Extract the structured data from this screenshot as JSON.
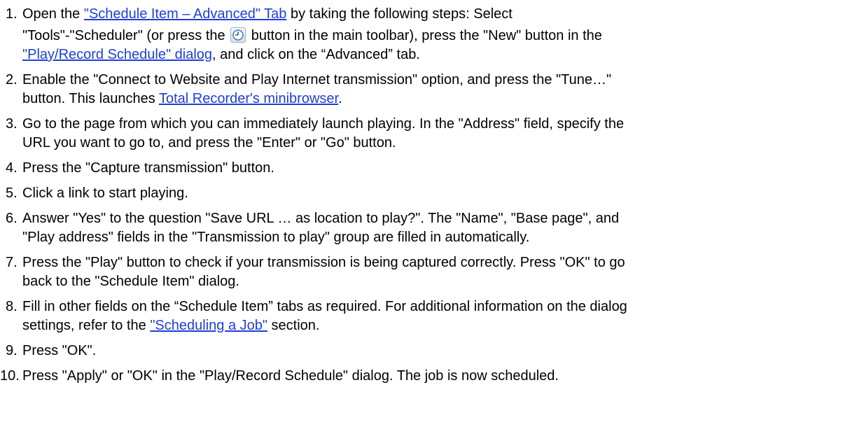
{
  "steps": [
    {
      "number": "1.",
      "line1": {
        "a": "Open the ",
        "link": "\"Schedule Item – Advanced\" Tab",
        "b": " by taking the following steps: Select"
      },
      "line2": {
        "a": "\"Tools\"-\"Scheduler\" (or press the ",
        "icon": "scheduler-clock-icon",
        "b": " button in the main toolbar), press the \"New\" button in the"
      },
      "line3": {
        "link": "\"Play/Record Schedule\" dialog",
        "b": ", and click on the “Advanced” tab."
      }
    },
    {
      "number": "2.",
      "line1": "Enable the \"Connect to Website and Play Internet transmission\" option, and press the \"Tune…\"",
      "line2": {
        "a": "button. This launches ",
        "link": "Total Recorder's minibrowser",
        "b": "."
      }
    },
    {
      "number": "3.",
      "line1": "Go to the page from which you can immediately launch playing. In the \"Address\" field, specify the",
      "line2": "URL you want to go to, and press the \"Enter\" or \"Go\" button."
    },
    {
      "number": "4.",
      "line1": "Press the \"Capture transmission\" button."
    },
    {
      "number": "5.",
      "line1": "Click a link to start playing."
    },
    {
      "number": "6.",
      "line1": "Answer \"Yes\" to the question \"Save URL … as location to play?\". The \"Name\", \"Base page\", and",
      "line2": "\"Play address\" fields in the \"Transmission to play\" group are filled in automatically."
    },
    {
      "number": "7.",
      "line1": "Press the \"Play\" button to check if your transmission is being captured correctly. Press \"OK\" to go",
      "line2": "back to the \"Schedule Item\" dialog."
    },
    {
      "number": "8.",
      "line1": "Fill in other fields on the “Schedule Item” tabs as required. For additional information on the dialog",
      "line2": {
        "a": "settings, refer to the ",
        "link": "\"Scheduling a Job\"",
        "b": " section."
      }
    },
    {
      "number": "9.",
      "line1": "Press \"OK\"."
    },
    {
      "number": "10.",
      "line1": "Press \"Apply\" or \"OK\" in the \"Play/Record Schedule\" dialog. The job is now scheduled."
    }
  ],
  "colors": {
    "link": "#1f3fd6",
    "text": "#000000",
    "background": "#ffffff"
  }
}
